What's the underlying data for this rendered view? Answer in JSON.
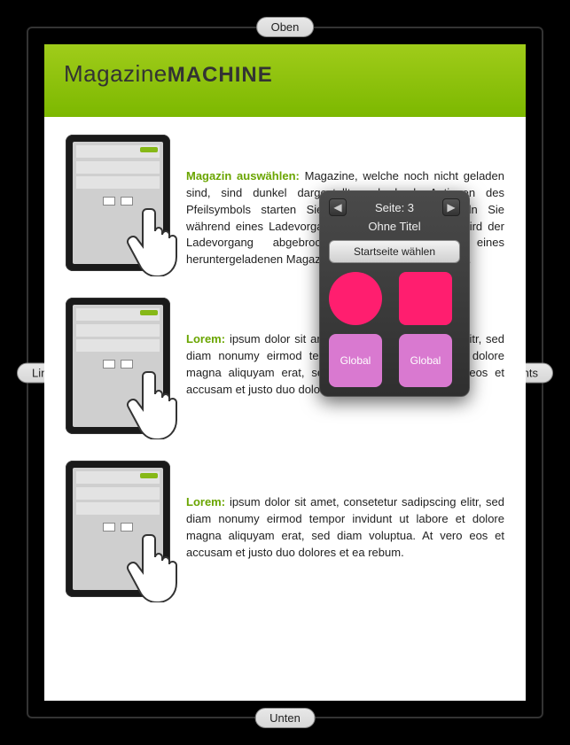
{
  "nav": {
    "top": "Oben",
    "bottom": "Unten",
    "left": "Links",
    "right": "Rechts"
  },
  "header": {
    "thin": "Magazine",
    "bold": "MACHINE"
  },
  "items": [
    {
      "label": "Magazin auswählen:",
      "text": "Magazine, welche noch nicht geladen sind, sind dunkel dargestellt und durch Antippen des Pfeilsymbols starten Sie den Download. Wechseln Sie während eines Ladevorgangs Ihr Magazinregal, so wird der Ladevorgang abgebrochen. Durch Antippen eines heruntergeladenen Magazins öffnen Sie das Dokument."
    },
    {
      "label": "Lorem:",
      "text": "ipsum dolor sit amet, consetetur sadipscing elitr, sed diam nonumy eirmod tempor invidunt ut labore et dolore magna aliquyam erat, sed diam voluptua. At vero eos et accusam et justo duo dolores et ea rebum."
    },
    {
      "label": "Lorem:",
      "text": "ipsum dolor sit amet, consetetur sadipscing elitr, sed diam nonumy eirmod tempor invidunt ut labore et dolore magna aliquyam erat, sed diam voluptua. At vero eos et accusam et justo duo dolores et ea rebum."
    }
  ],
  "popup": {
    "page_label": "Seite: 3",
    "subtitle": "Ohne Titel",
    "action": "Startseite wählen",
    "global": "Global"
  }
}
